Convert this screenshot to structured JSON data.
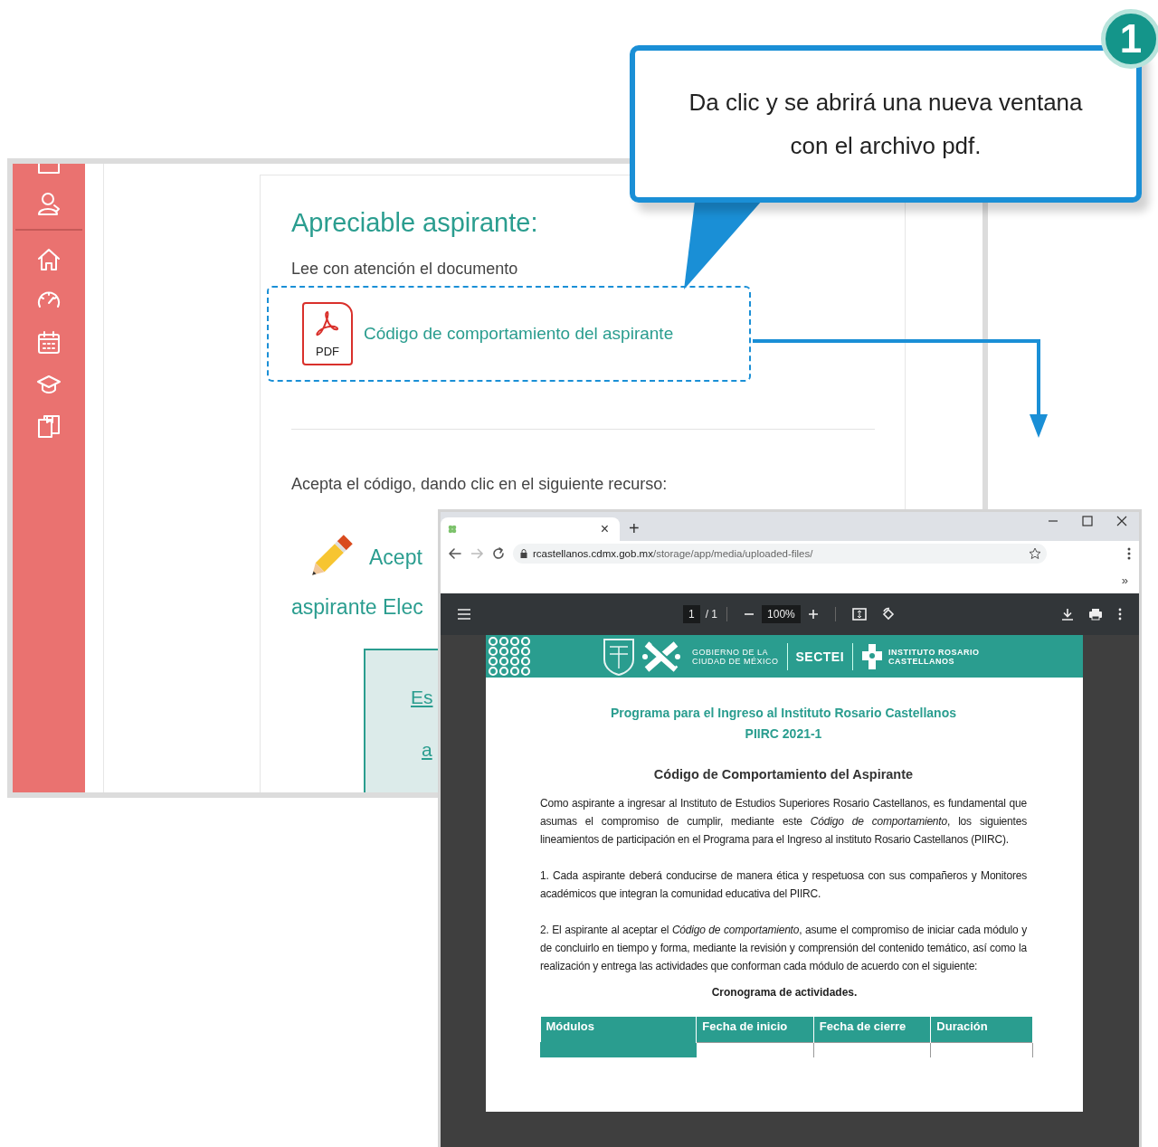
{
  "callout": {
    "badge": "1",
    "text": "Da clic y se abrirá una nueva ventana con el archivo pdf."
  },
  "portal": {
    "heading": "Apreciable aspirante:",
    "instruction": "Lee con atención el documento",
    "document": {
      "file_label": "PDF",
      "link": "Código de comportamiento del aspirante"
    },
    "accept_prompt": "Acepta el código, dando clic en el siguiente recurso:",
    "accept_link_lines": [
      "Acept",
      "aspirante Elec"
    ],
    "notice_lines": [
      "Es",
      "a"
    ]
  },
  "browser": {
    "tab_close": "×",
    "new_tab": "+",
    "url_domain": "rcastellanos.cdmx.gob.mx",
    "url_path": "/storage/app/media/uploaded-files/",
    "bookmarks_overflow": "»",
    "pdf_toolbar": {
      "page": "1",
      "page_total": "/ 1",
      "zoom": "100%"
    },
    "document": {
      "header_lines": [
        [
          "GOBIERNO DE LA",
          "CIUDAD DE MÉXICO"
        ],
        [
          "SECTEI"
        ],
        [
          "INSTITUTO ROSARIO",
          "CASTELLANOS"
        ]
      ],
      "title_lines": [
        "Programa para el Ingreso al Instituto Rosario Castellanos",
        "PIIRC 2021-1"
      ],
      "subtitle": "Código de Comportamiento del Aspirante",
      "paragraphs": [
        "Como aspirante a ingresar al Instituto de Estudios Superiores Rosario Castellanos, es fundamental que asumas el compromiso de cumplir, mediante este *Código de comportamiento*, los siguientes lineamientos de participación en el Programa para el Ingreso al instituto Rosario Castellanos (PIIRC).",
        "1. Cada aspirante deberá conducirse de manera ética y respetuosa con sus compañeros y Monitores académicos que integran la comunidad educativa del PIIRC.",
        "2. El aspirante al aceptar el *Código de comportamiento*, asume el compromiso de iniciar cada módulo y de concluirlo en tiempo y forma, mediante la revisión y comprensión del contenido temático, así como la realización y entrega las actividades que conforman cada módulo de acuerdo con el siguiente:"
      ],
      "table_caption": "Cronograma de actividades.",
      "table_columns": [
        "Módulos",
        "Fecha de inicio",
        "Fecha de cierre",
        "Duración"
      ]
    }
  }
}
